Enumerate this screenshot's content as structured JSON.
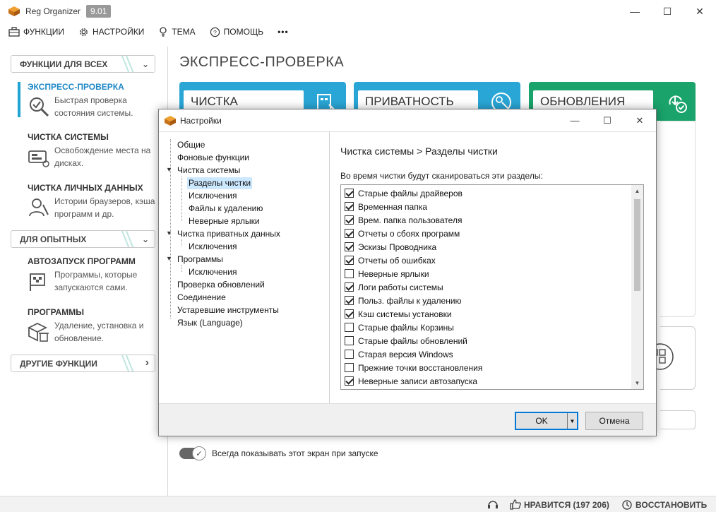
{
  "app": {
    "title": "Reg Organizer",
    "version": "9.01"
  },
  "window_controls": {
    "minimize": "—",
    "maximize": "☐",
    "close": "✕"
  },
  "menu": [
    {
      "label": "ФУНКЦИИ",
      "icon": "toolbox-icon"
    },
    {
      "label": "НАСТРОЙКИ",
      "icon": "gear-icon"
    },
    {
      "label": "ТЕМА",
      "icon": "lightbulb-icon"
    },
    {
      "label": "ПОМОЩЬ",
      "icon": "question-icon"
    },
    {
      "label": "•••",
      "icon": "more-icon"
    }
  ],
  "sidebar": {
    "sections": [
      {
        "label": "ФУНКЦИИ ДЛЯ ВСЕХ",
        "chevron": "⌄"
      },
      {
        "label": "ДЛЯ ОПЫТНЫХ",
        "chevron": "⌄"
      },
      {
        "label": "ДРУГИЕ ФУНКЦИИ",
        "chevron": "›"
      }
    ],
    "items": [
      {
        "title": "ЭКСПРЕСС-ПРОВЕРКА",
        "desc": "Быстрая проверка состояния системы.",
        "icon": "magnifier-check-icon",
        "active": true
      },
      {
        "title": "ЧИСТКА СИСТЕМЫ",
        "desc": "Освобождение места на дисках.",
        "icon": "disk-clean-icon"
      },
      {
        "title": "ЧИСТКА ЛИЧНЫХ ДАННЫХ",
        "desc": "Истории браузеров, кэша программ и др.",
        "icon": "privacy-brush-icon"
      },
      {
        "title": "АВТОЗАПУСК ПРОГРАММ",
        "desc": "Программы, которые запускаются сами.",
        "icon": "autostart-flag-icon"
      },
      {
        "title": "ПРОГРАММЫ",
        "desc": "Удаление, установка и обновление.",
        "icon": "box-trash-icon"
      }
    ]
  },
  "main": {
    "title": "ЭКСПРЕСС-ПРОВЕРКА",
    "tiles": [
      {
        "label": "ЧИСТКА",
        "color": "#2aa6d6",
        "icon": "registry-clean-icon"
      },
      {
        "label": "ПРИВАТНОСТЬ",
        "color": "#2aa6d6",
        "icon": "privacy-icon"
      },
      {
        "label": "ОБНОВЛЕНИЯ",
        "color": "#1aa36b",
        "icon": "download-check-icon"
      }
    ],
    "startup_toggle": {
      "label": "Всегда показывать этот экран при запуске",
      "on": true
    }
  },
  "status": {
    "likes": "НРАВИТСЯ (197 206)",
    "restore": "ВОССТАНОВИТЬ"
  },
  "dialog": {
    "title": "Настройки",
    "tree": [
      {
        "label": "Общие",
        "level": 0
      },
      {
        "label": "Фоновые функции",
        "level": 0
      },
      {
        "label": "Чистка системы",
        "level": 0,
        "expanded": true
      },
      {
        "label": "Разделы чистки",
        "level": 1,
        "selected": true
      },
      {
        "label": "Исключения",
        "level": 1
      },
      {
        "label": "Файлы к удалению",
        "level": 1
      },
      {
        "label": "Неверные ярлыки",
        "level": 1
      },
      {
        "label": "Чистка приватных данных",
        "level": 0,
        "expanded": true
      },
      {
        "label": "Исключения",
        "level": 1
      },
      {
        "label": "Программы",
        "level": 0,
        "expanded": true
      },
      {
        "label": "Исключения",
        "level": 1
      },
      {
        "label": "Проверка обновлений",
        "level": 0
      },
      {
        "label": "Соединение",
        "level": 0
      },
      {
        "label": "Устаревшие инструменты",
        "level": 0
      },
      {
        "label": "Язык (Language)",
        "level": 0
      }
    ],
    "breadcrumb": "Чистка системы > Разделы чистки",
    "list_caption": "Во время чистки будут сканироваться эти разделы:",
    "checks": [
      {
        "label": "Старые файлы драйверов",
        "checked": true
      },
      {
        "label": "Временная папка",
        "checked": true
      },
      {
        "label": "Врем. папка пользователя",
        "checked": true
      },
      {
        "label": "Отчеты о сбоях программ",
        "checked": true
      },
      {
        "label": "Эскизы Проводника",
        "checked": true
      },
      {
        "label": "Отчеты об ошибках",
        "checked": true
      },
      {
        "label": "Неверные ярлыки",
        "checked": false
      },
      {
        "label": "Логи работы системы",
        "checked": true
      },
      {
        "label": "Польз. файлы к удалению",
        "checked": true
      },
      {
        "label": "Кэш системы установки",
        "checked": true
      },
      {
        "label": "Старые файлы Корзины",
        "checked": false
      },
      {
        "label": "Старые файлы обновлений",
        "checked": false
      },
      {
        "label": "Старая версия Windows",
        "checked": false
      },
      {
        "label": "Прежние точки восстановления",
        "checked": false
      },
      {
        "label": "Неверные записи автозапуска",
        "checked": true
      }
    ],
    "ok_label": "OK",
    "cancel_label": "Отмена"
  }
}
